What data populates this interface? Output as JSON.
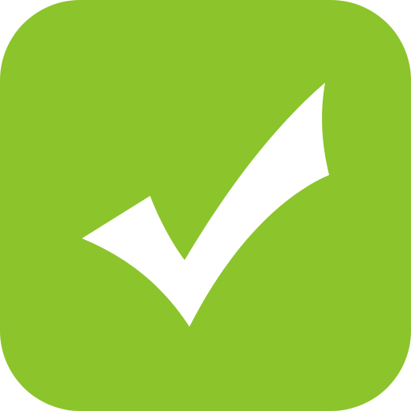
{
  "icon": {
    "name": "checkmark-icon",
    "background_color": "#8cc42c",
    "mark_color": "#ffffff"
  }
}
